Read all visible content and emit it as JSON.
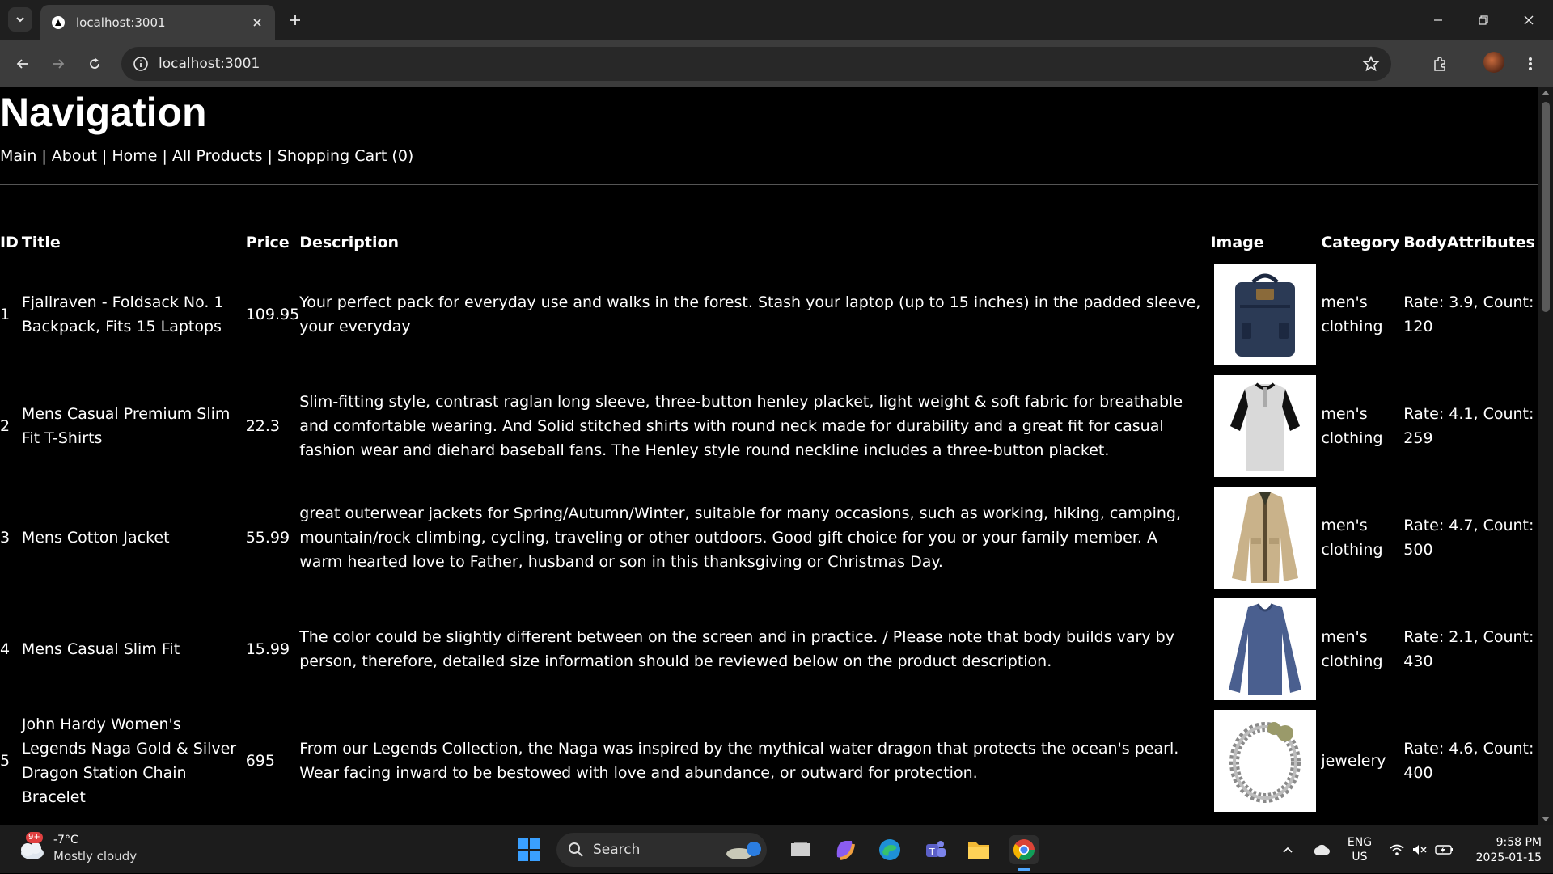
{
  "browser": {
    "tab_title": "localhost:3001",
    "url": "localhost:3001"
  },
  "page": {
    "heading": "Navigation",
    "nav_links": [
      "Main",
      "About",
      "Home",
      "All Products",
      "Shopping Cart (0)"
    ],
    "nav_separator": "|",
    "table": {
      "headers": {
        "id": "ID",
        "title": "Title",
        "price": "Price",
        "description": "Description",
        "image": "Image",
        "category": "Category",
        "body": "BodyAttributes"
      },
      "rows": [
        {
          "id": "1",
          "title": "Fjallraven - Foldsack No. 1 Backpack, Fits 15 Laptops",
          "price": "109.95",
          "description": "Your perfect pack for everyday use and walks in the forest. Stash your laptop (up to 15 inches) in the padded sleeve, your everyday",
          "image_icon": "backpack-image",
          "category": "men's clothing",
          "attributes": "Rate: 3.9, Count: 120"
        },
        {
          "id": "2",
          "title": "Mens Casual Premium Slim Fit T-Shirts",
          "price": "22.3",
          "description": "Slim-fitting style, contrast raglan long sleeve, three-button henley placket, light weight & soft fabric for breathable and comfortable wearing. And Solid stitched shirts with round neck made for durability and a great fit for casual fashion wear and diehard baseball fans. The Henley style round neckline includes a three-button placket.",
          "image_icon": "tshirt-image",
          "category": "men's clothing",
          "attributes": "Rate: 4.1, Count: 259"
        },
        {
          "id": "3",
          "title": "Mens Cotton Jacket",
          "price": "55.99",
          "description": "great outerwear jackets for Spring/Autumn/Winter, suitable for many occasions, such as working, hiking, camping, mountain/rock climbing, cycling, traveling or other outdoors. Good gift choice for you or your family member. A warm hearted love to Father, husband or son in this thanksgiving or Christmas Day.",
          "image_icon": "jacket-image",
          "category": "men's clothing",
          "attributes": "Rate: 4.7, Count: 500"
        },
        {
          "id": "4",
          "title": "Mens Casual Slim Fit",
          "price": "15.99",
          "description": "The color could be slightly different between on the screen and in practice. / Please note that body builds vary by person, therefore, detailed size information should be reviewed below on the product description.",
          "image_icon": "longsleeve-shirt-image",
          "category": "men's clothing",
          "attributes": "Rate: 2.1, Count: 430"
        },
        {
          "id": "5",
          "title": "John Hardy Women's Legends Naga Gold & Silver Dragon Station Chain Bracelet",
          "price": "695",
          "description": "From our Legends Collection, the Naga was inspired by the mythical water dragon that protects the ocean's pearl. Wear facing inward to be bestowed with love and abundance, or outward for protection.",
          "image_icon": "bracelet-image",
          "category": "jewelery",
          "attributes": "Rate: 4.6, Count: 400"
        }
      ]
    }
  },
  "taskbar": {
    "weather_temp": "-7°C",
    "weather_cond": "Mostly cloudy",
    "weather_badge": "9+",
    "search_label": "Search",
    "lang_top": "ENG",
    "lang_bottom": "US",
    "time": "9:58 PM",
    "date": "2025-01-15"
  }
}
